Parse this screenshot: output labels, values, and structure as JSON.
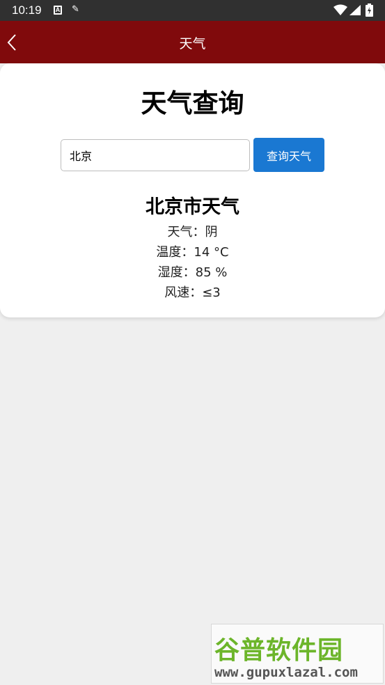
{
  "status_bar": {
    "time": "10:19",
    "notification_icon_letter": "A"
  },
  "app_bar": {
    "title": "天气"
  },
  "main": {
    "heading": "天气查询",
    "search": {
      "value": "北京",
      "button_label": "查询天气"
    },
    "result": {
      "title": "北京市天气",
      "lines": [
        "天气：阴",
        "温度：14 °C",
        "湿度：85 %",
        "风速：≤3"
      ]
    }
  },
  "watermark": {
    "brand": "谷普软件园",
    "url": "www.gupuxlazal.com"
  },
  "colors": {
    "app_bar": "#800a0c",
    "button": "#1a78d2",
    "background": "#efefef"
  },
  "icons": [
    "a-notification-icon",
    "wrench-icon",
    "wifi-icon",
    "signal-icon",
    "battery-icon",
    "back-arrow-icon"
  ]
}
